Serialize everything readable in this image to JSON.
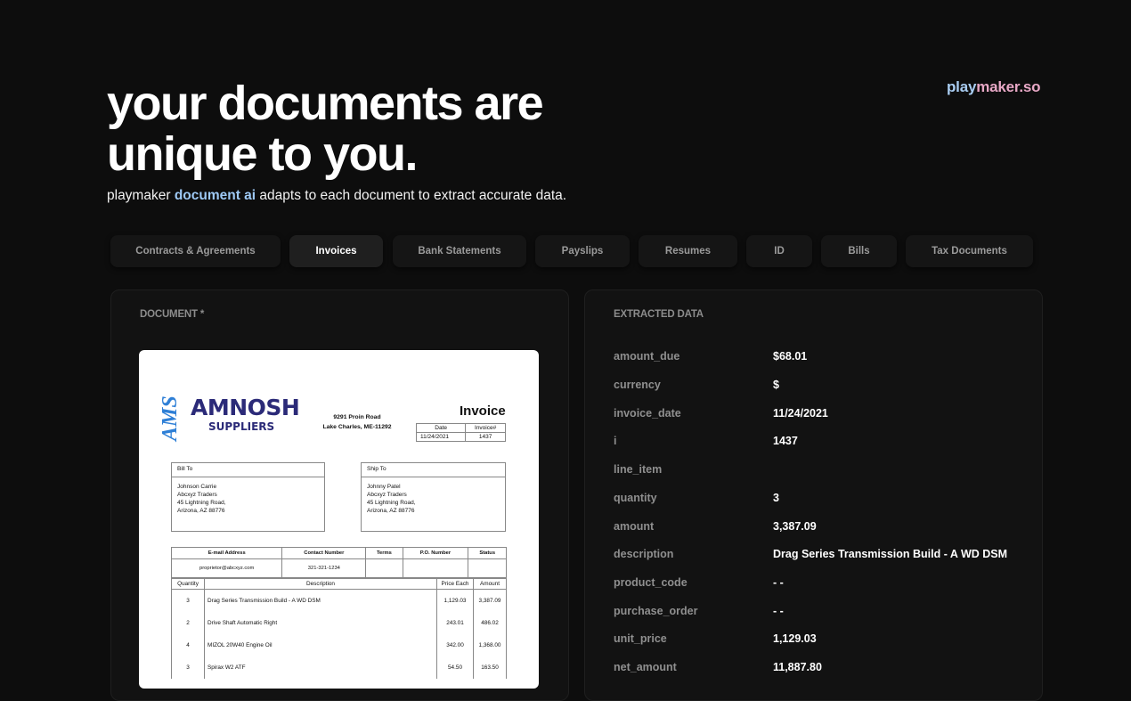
{
  "brand": {
    "part1": "play",
    "part2": "maker.so"
  },
  "hero": {
    "title_line1": "your documents are",
    "title_line2": "unique to you.",
    "sub_before": "playmaker ",
    "sub_highlight": "document ai",
    "sub_after": " adapts to each document to extract accurate data."
  },
  "tabs": [
    "Contracts & Agreements",
    "Invoices",
    "Bank Statements",
    "Payslips",
    "Resumes",
    "ID",
    "Bills",
    "Tax Documents"
  ],
  "active_tab": "Invoices",
  "document_panel": {
    "label": "DOCUMENT *"
  },
  "extracted_panel": {
    "label": "EXTRACTED DATA"
  },
  "invoice": {
    "logo_mark": "AMS",
    "company": "AMNOSH",
    "company_sub": "SUPPLIERS",
    "address_line1": "9291 Proin Road",
    "address_line2": "Lake Charles, ME-11292",
    "title": "Invoice",
    "date_header": "Date",
    "number_header": "Invoice#",
    "date": "11/24/2021",
    "number": "1437",
    "bill_to_label": "Bill To",
    "bill_to": [
      "Johnson Carrie",
      "Abcxyz Traders",
      "45 Lightning Road,",
      "Arizona, AZ 88776"
    ],
    "ship_to_label": "Ship To",
    "ship_to": [
      "Johnny Patel",
      "Abcxyz Traders",
      "45 Lightning Road,",
      "Arizona, AZ 88776"
    ],
    "info_headers": [
      "E-mail Address",
      "Contact Number",
      "Terms",
      "P.O. Number",
      "Status"
    ],
    "info_values": [
      "proprietor@abcxyz.com",
      "321-321-1234",
      "",
      "",
      ""
    ],
    "item_headers": [
      "Quantity",
      "Description",
      "Price Each",
      "Amount"
    ],
    "items": [
      {
        "qty": "3",
        "desc": "Drag Series Transmission Build - A WD DSM",
        "price": "1,129.03",
        "amount": "3,387.09"
      },
      {
        "qty": "2",
        "desc": "Drive Shaft Automatic Right",
        "price": "243.01",
        "amount": "486.02"
      },
      {
        "qty": "4",
        "desc": "MIZOL 20W40 Engine Oil",
        "price": "342.00",
        "amount": "1,368.00"
      },
      {
        "qty": "3",
        "desc": "Spirax W2 ATF",
        "price": "54.50",
        "amount": "163.50"
      }
    ]
  },
  "extracted": [
    {
      "key": "amount_due",
      "value": "$68.01"
    },
    {
      "key": "currency",
      "value": "$"
    },
    {
      "key": "invoice_date",
      "value": "11/24/2021"
    },
    {
      "key": "i",
      "value": "1437"
    },
    {
      "key": "line_item",
      "value": ""
    },
    {
      "key": "quantity",
      "value": "3"
    },
    {
      "key": "amount",
      "value": "3,387.09"
    },
    {
      "key": "description",
      "value": "Drag Series Transmission Build - A WD DSM"
    },
    {
      "key": "product_code",
      "value": "- -"
    },
    {
      "key": "purchase_order",
      "value": "- -"
    },
    {
      "key": "unit_price",
      "value": "1,129.03"
    },
    {
      "key": "net_amount",
      "value": "11,887.80"
    }
  ]
}
